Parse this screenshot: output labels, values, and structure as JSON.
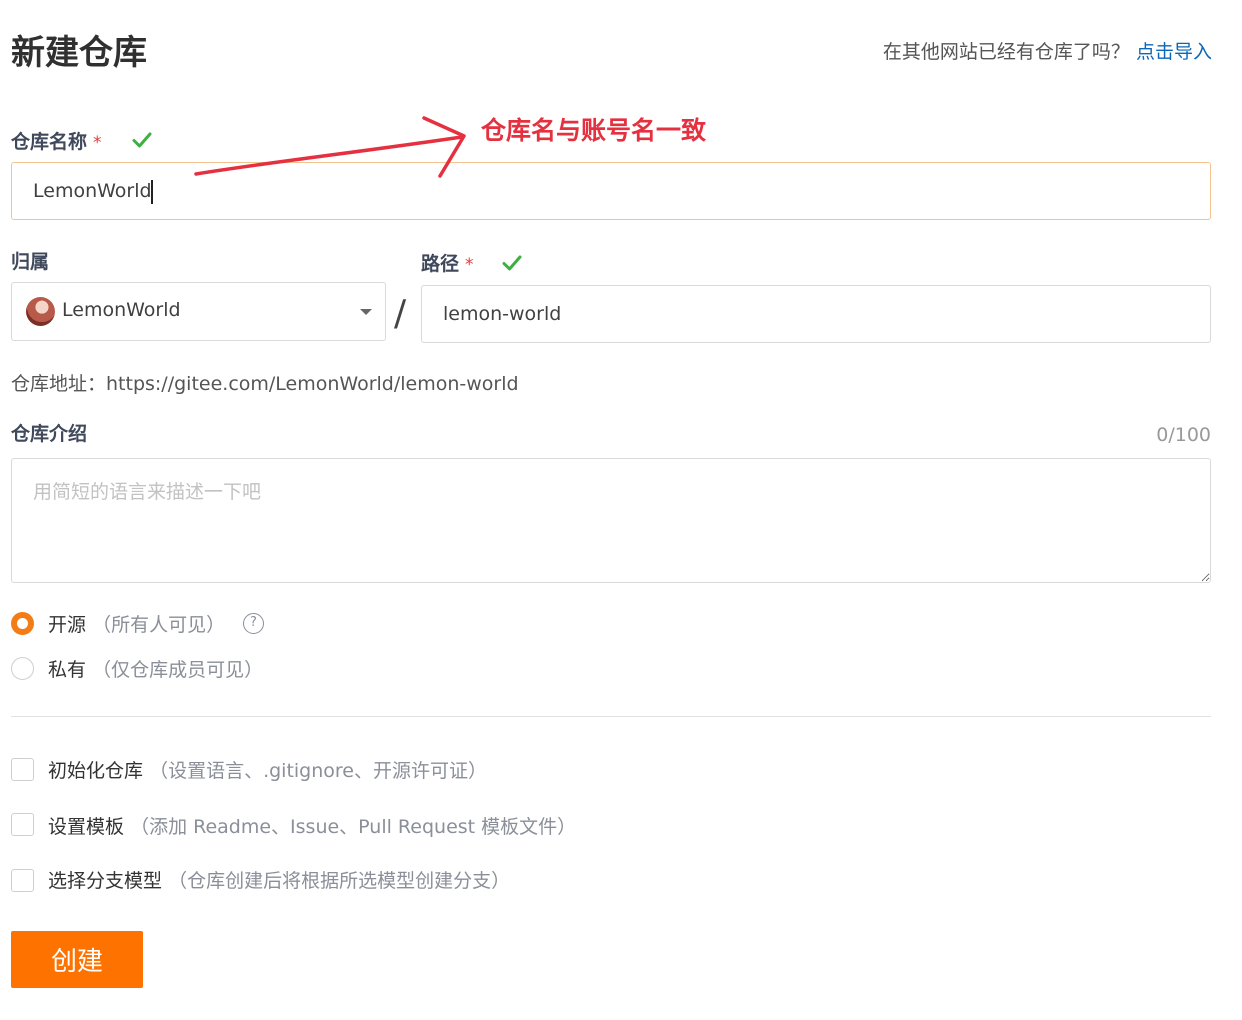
{
  "page": {
    "title": "新建仓库",
    "import_hint": "在其他网站已经有仓库了吗？",
    "import_link": "点击导入"
  },
  "repo_name": {
    "label": "仓库名称",
    "required_mark": "*",
    "value": "LemonWorld",
    "valid": true
  },
  "annotation": {
    "text": "仓库名与账号名一致",
    "color": "#e5303f"
  },
  "owner": {
    "label": "归属",
    "value": "LemonWorld",
    "separator": "/"
  },
  "path": {
    "label": "路径",
    "required_mark": "*",
    "value": "lemon-world",
    "valid": true
  },
  "repo_url": {
    "text": "仓库地址：https://gitee.com/LemonWorld/lemon-world"
  },
  "description": {
    "label": "仓库介绍",
    "counter": "0/100",
    "placeholder": "用简短的语言来描述一下吧",
    "value": ""
  },
  "visibility": {
    "selected": "public",
    "public_label": "开源",
    "public_note": "（所有人可见）",
    "help_glyph": "?",
    "private_label": "私有",
    "private_note": "（仅仓库成员可见）"
  },
  "options": [
    {
      "label": "初始化仓库",
      "note": "（设置语言、.gitignore、开源许可证）",
      "checked": false
    },
    {
      "label": "设置模板",
      "note": "（添加 Readme、Issue、Pull Request 模板文件）",
      "checked": false
    },
    {
      "label": "选择分支模型",
      "note": "（仓库创建后将根据所选模型创建分支）",
      "checked": false
    }
  ],
  "submit": {
    "label": "创建"
  },
  "colors": {
    "accent": "#fe7300",
    "link": "#0b67b8",
    "valid": "#3cb043",
    "required": "#e8393a"
  }
}
